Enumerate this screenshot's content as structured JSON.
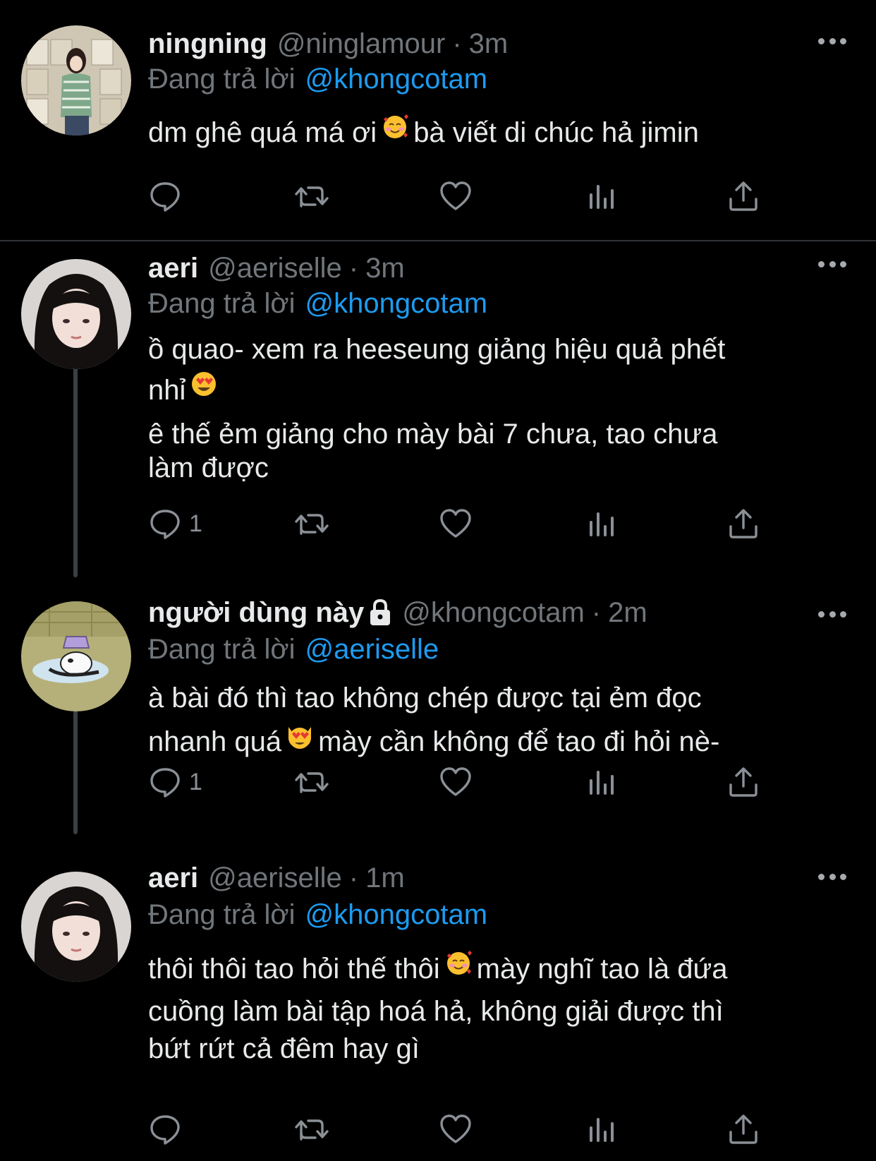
{
  "tweets": [
    {
      "name": "ningning",
      "handle": "@ninglamour",
      "dot": "·",
      "time": "3m",
      "reply_prefix": "Đang trả lời",
      "reply_to": "@khongcotam",
      "lines": [
        {
          "before": "dm ghê quá má ơi",
          "emoji": "smiling-face-with-hearts",
          "after": "bà viết di chúc hả jimin"
        }
      ],
      "reply_count": ""
    },
    {
      "name": "aeri",
      "handle": "@aeriselle",
      "dot": "·",
      "time": "3m",
      "reply_prefix": "Đang trả lời",
      "reply_to": "@khongcotam",
      "lines": [
        {
          "text": "ồ quao- xem ra heeseung giảng hiệu quả phết"
        },
        {
          "before": "nhỉ",
          "emoji": "heart-eyes-face",
          "after": ""
        },
        {
          "text": "ê thế ẻm giảng cho mày bài 7 chưa, tao chưa"
        },
        {
          "text": "làm được"
        }
      ],
      "reply_count": "1"
    },
    {
      "name": "người dùng này",
      "handle": "@khongcotam",
      "dot": "·",
      "time": "2m",
      "reply_prefix": "Đang trả lời",
      "reply_to": "@aeriselle",
      "lines": [
        {
          "text": "à bài đó thì tao không chép được tại ẻm đọc"
        },
        {
          "before": "nhanh quá",
          "emoji": "heart-eyes-cat",
          "after": "mày cần không để tao đi hỏi nè-"
        }
      ],
      "reply_count": "1"
    },
    {
      "name": "aeri",
      "handle": "@aeriselle",
      "dot": "·",
      "time": "1m",
      "reply_prefix": "Đang trả lời",
      "reply_to": "@khongcotam",
      "lines": [
        {
          "before": "thôi thôi tao hỏi thế thôi",
          "emoji": "smiling-face-with-hearts",
          "after": "mày nghĩ tao là đứa"
        },
        {
          "text": "cuồng làm bài tập hoá hả, không giải được thì"
        },
        {
          "text": "bứt rứt cả đêm hay gì"
        }
      ],
      "reply_count": ""
    }
  ],
  "icons": {
    "reply": "reply-bubble-icon",
    "retweet": "retweet-icon",
    "like": "heart-icon",
    "views": "views-bar-chart-icon",
    "share": "share-upload-icon",
    "more": "more-dots-icon",
    "lock": "lock-icon"
  },
  "colors": {
    "background": "#000000",
    "text": "#e7e9ea",
    "muted": "#71767b",
    "mention": "#1d9bf0",
    "icon": "#8b9096"
  }
}
